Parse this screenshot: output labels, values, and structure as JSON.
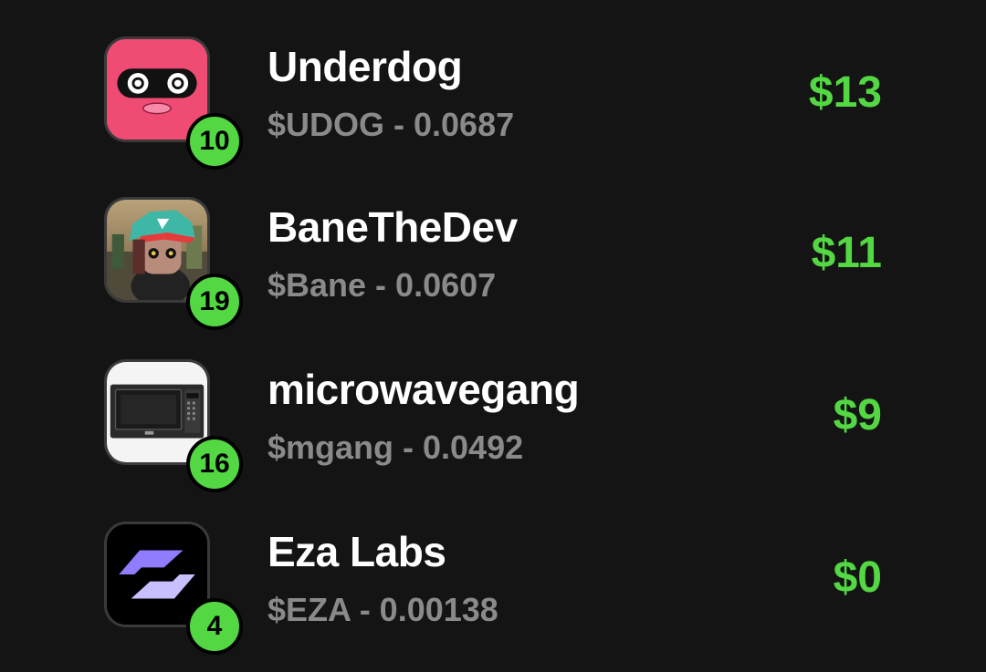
{
  "items": [
    {
      "name": "Underdog",
      "subtitle": "$UDOG - 0.0687",
      "value": "$13",
      "rank": "10",
      "avatar_icon": "masked-face-avatar"
    },
    {
      "name": "BaneTheDev",
      "subtitle": "$Bane - 0.0607",
      "value": "$11",
      "rank": "19",
      "avatar_icon": "cap-character-avatar"
    },
    {
      "name": "microwavegang",
      "subtitle": "$mgang - 0.0492",
      "value": "$9",
      "rank": "16",
      "avatar_icon": "microwave-avatar"
    },
    {
      "name": "Eza Labs",
      "subtitle": "$EZA - 0.00138",
      "value": "$0",
      "rank": "4",
      "avatar_icon": "eza-logo-avatar"
    }
  ],
  "colors": {
    "background": "#141414",
    "accent_green": "#53d843",
    "title_text": "#ffffff",
    "subtitle_text": "#8a8a8a"
  }
}
